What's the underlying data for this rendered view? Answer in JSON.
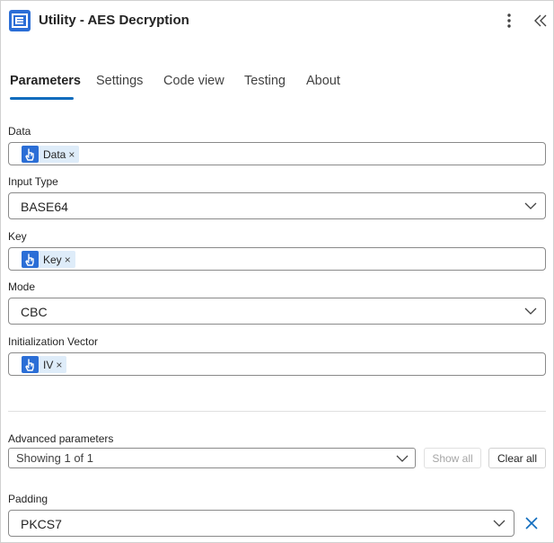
{
  "header": {
    "title": "Utility - AES Decryption",
    "logo_icon": "app-logo-icon",
    "more_icon": "more-vertical-icon",
    "collapse_icon": "double-chevron-left-icon"
  },
  "tabs": [
    {
      "label": "Parameters",
      "active": true
    },
    {
      "label": "Settings",
      "active": false
    },
    {
      "label": "Code view",
      "active": false
    },
    {
      "label": "Testing",
      "active": false
    },
    {
      "label": "About",
      "active": false
    }
  ],
  "fields": {
    "data": {
      "label": "Data",
      "token": "Data",
      "token_remove": "×"
    },
    "input_type": {
      "label": "Input Type",
      "value": "BASE64"
    },
    "key": {
      "label": "Key",
      "token": "Key",
      "token_remove": "×"
    },
    "mode": {
      "label": "Mode",
      "value": "CBC"
    },
    "iv": {
      "label": "Initialization Vector",
      "token": "IV",
      "token_remove": "×"
    }
  },
  "advanced": {
    "label": "Advanced parameters",
    "selected": "Showing 1 of 1",
    "show_all": "Show all",
    "clear_all": "Clear all"
  },
  "padding": {
    "label": "Padding",
    "value": "PKCS7"
  },
  "colors": {
    "accent": "#0f6cbd",
    "token_bg": "#deecf9",
    "token_icon_bg": "#2b6ed6"
  }
}
